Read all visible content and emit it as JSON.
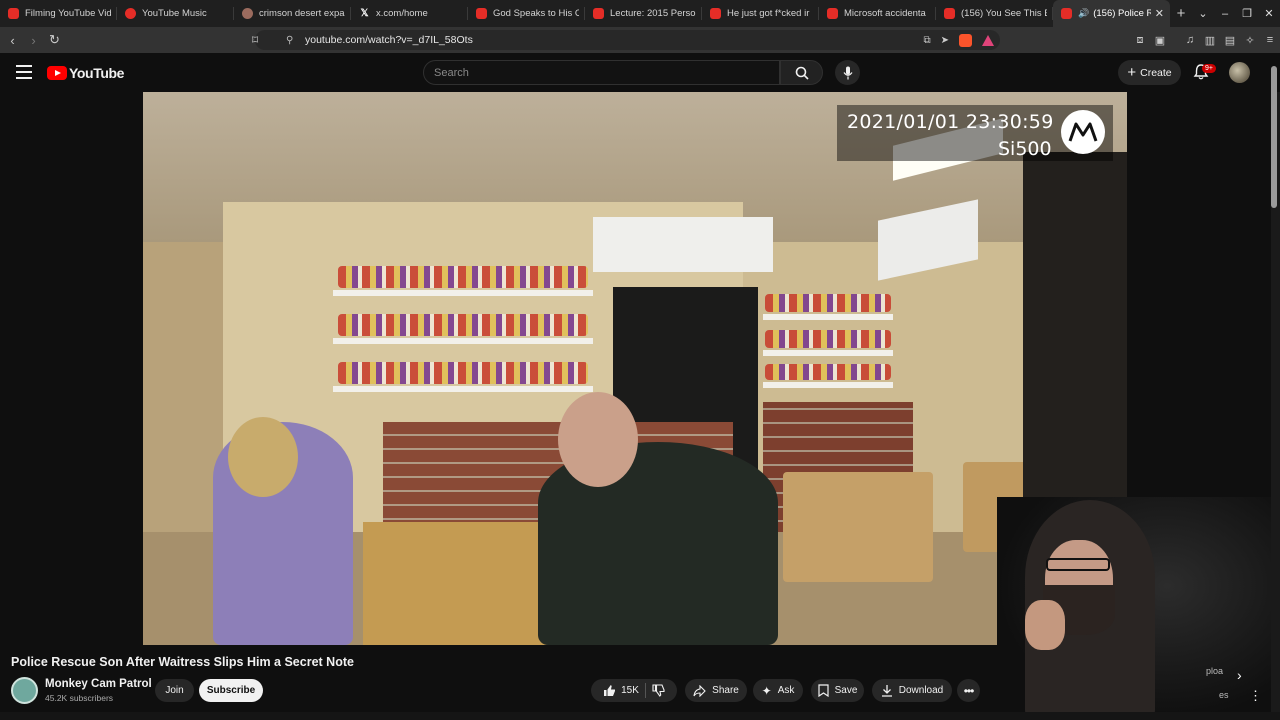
{
  "browser": {
    "tabs": [
      {
        "title": "Filming YouTube Vid",
        "icon": "youtube-icon"
      },
      {
        "title": "YouTube Music",
        "icon": "youtube-music-icon"
      },
      {
        "title": "crimson desert expa",
        "icon": "web-icon"
      },
      {
        "title": "x.com/home",
        "icon": "x-icon"
      },
      {
        "title": "God Speaks to His C",
        "icon": "youtube-icon"
      },
      {
        "title": "Lecture: 2015 Perso",
        "icon": "youtube-icon"
      },
      {
        "title": "He just got f*cked ir",
        "icon": "youtube-icon"
      },
      {
        "title": "Microsoft accidenta",
        "icon": "youtube-icon"
      },
      {
        "title": "(156) You See This B",
        "icon": "youtube-icon"
      },
      {
        "title": "(156) Police R",
        "icon": "youtube-icon",
        "active": true
      }
    ],
    "url": "youtube.com/watch?v=_d7IL_58Ots"
  },
  "header": {
    "logo_text": "YouTube",
    "search_placeholder": "Search",
    "create_label": "Create",
    "notif_badge": "9+"
  },
  "video": {
    "timestamp": "2021/01/01 23:30:59",
    "device": "Si500"
  },
  "watch": {
    "title": "Police Rescue Son After Waitress Slips Him a Secret Note",
    "channel": "Monkey Cam Patrol",
    "subscribers": "45.2K subscribers",
    "join_label": "Join",
    "subscribe_label": "Subscribe",
    "likes": "15K",
    "share_label": "Share",
    "ask_label": "Ask",
    "save_label": "Save",
    "download_label": "Download",
    "side_text_1": "ploa",
    "side_text_2": "es"
  }
}
